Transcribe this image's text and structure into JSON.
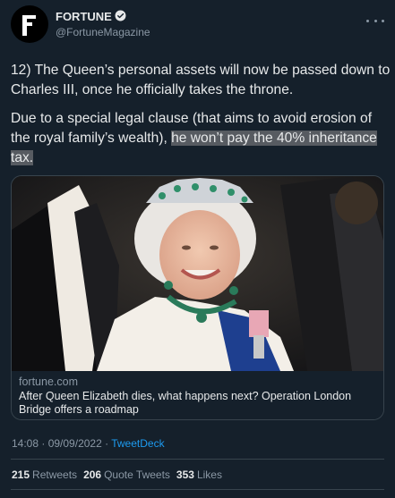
{
  "author": {
    "display_name": "FORTUNE",
    "handle": "@FortuneMagazine",
    "avatar_letter": "F",
    "verified": true,
    "avatar_icon": "fortune-logo"
  },
  "tweet": {
    "paragraph1": "12) The Queen’s personal assets will now be passed down to Charles III, once he officially takes the throne.",
    "paragraph2_plain": "Due to a special legal clause (that aims to avoid erosion of the royal family’s wealth), ",
    "paragraph2_highlight": "he won’t pay the 40% inheritance tax."
  },
  "link_card": {
    "domain": "fortune.com",
    "title": "After Queen Elizabeth dies, what happens next? Operation London Bridge offers a roadmap"
  },
  "meta": {
    "time": "14:08",
    "separator": " · ",
    "date": "09/09/2022",
    "source": "TweetDeck"
  },
  "stats": {
    "retweets_count": "215",
    "retweets_label": "Retweets",
    "quotes_count": "206",
    "quotes_label": "Quote Tweets",
    "likes_count": "353",
    "likes_label": "Likes"
  },
  "colors": {
    "background": "#15202b",
    "text": "#e7e9ea",
    "secondary": "#8b98a5",
    "accent": "#1d9bf0",
    "highlight": "#575b61"
  }
}
